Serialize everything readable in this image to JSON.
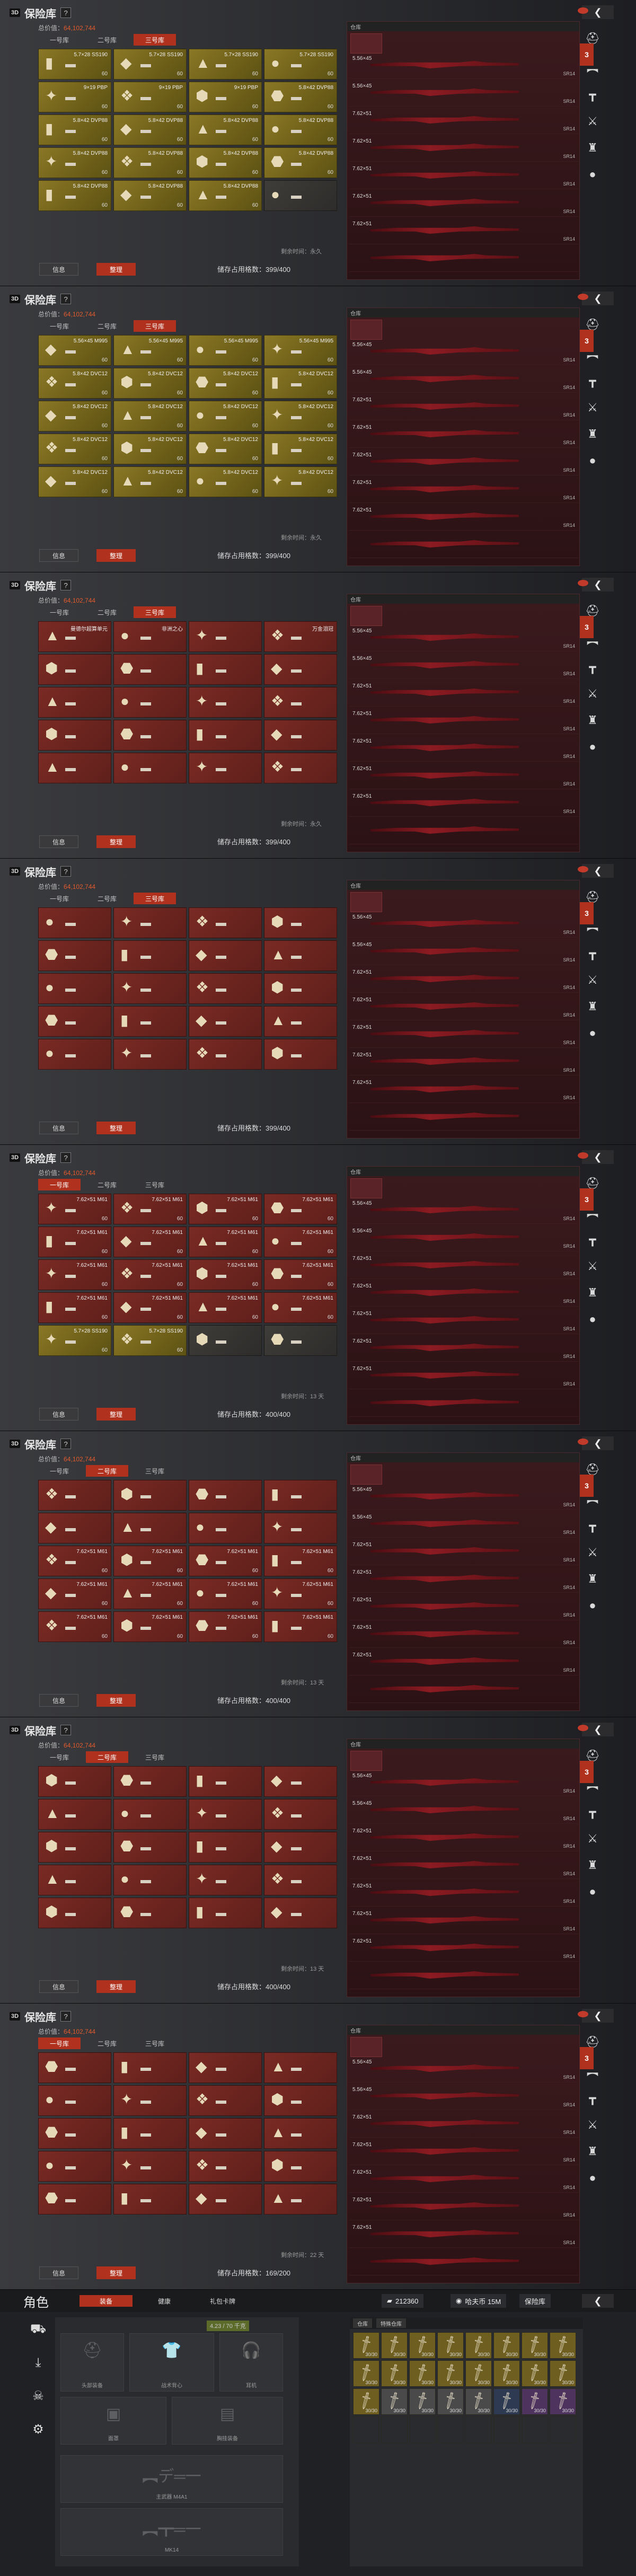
{
  "panels": [
    {
      "title": "保险库",
      "total_label": "总价值：",
      "total_value": "64,102,744",
      "tabs": [
        "一号库",
        "二号库",
        "三号库"
      ],
      "active_tab": 2,
      "cells": [
        {
          "t": "gold",
          "n": "5.7×28 SS190",
          "c": "60"
        },
        {
          "t": "gold",
          "n": "5.7×28 SS190",
          "c": "60"
        },
        {
          "t": "gold",
          "n": "5.7×28 SS190",
          "c": "60"
        },
        {
          "t": "gold",
          "n": "5.7×28 SS190",
          "c": "60"
        },
        {
          "t": "gold",
          "n": "9×19 PBP",
          "c": "60"
        },
        {
          "t": "gold",
          "n": "9×19 PBP",
          "c": "60"
        },
        {
          "t": "gold",
          "n": "9×19 PBP",
          "c": "60"
        },
        {
          "t": "gold",
          "n": "5.8×42 DVP88",
          "c": "60"
        },
        {
          "t": "gold",
          "n": "5.8×42 DVP88",
          "c": "60"
        },
        {
          "t": "gold",
          "n": "5.8×42 DVP88",
          "c": "60"
        },
        {
          "t": "gold",
          "n": "5.8×42 DVP88",
          "c": "60"
        },
        {
          "t": "gold",
          "n": "5.8×42 DVP88",
          "c": "60"
        },
        {
          "t": "gold",
          "n": "5.8×42 DVP88",
          "c": "60"
        },
        {
          "t": "gold",
          "n": "5.8×42 DVP88",
          "c": "60"
        },
        {
          "t": "gold",
          "n": "5.8×42 DVP88",
          "c": "60"
        },
        {
          "t": "gold",
          "n": "5.8×42 DVP88",
          "c": "60"
        },
        {
          "t": "gold",
          "n": "5.8×42 DVP88",
          "c": "60"
        },
        {
          "t": "gold",
          "n": "5.8×42 DVP88",
          "c": "60"
        },
        {
          "t": "gold",
          "n": "5.8×42 DVP88",
          "c": "60"
        },
        {
          "t": "dark",
          "n": "",
          "c": ""
        }
      ],
      "remaining": "剩余时间：永久",
      "usage": "储存占用格数：399/400",
      "btn_info": "信息",
      "btn_sort": "整理"
    },
    {
      "title": "保险库",
      "total_label": "总价值：",
      "total_value": "64,102,744",
      "tabs": [
        "一号库",
        "二号库",
        "三号库"
      ],
      "active_tab": 2,
      "cells": [
        {
          "t": "gold",
          "n": "5.56×45 M995",
          "c": "60"
        },
        {
          "t": "gold",
          "n": "5.56×45 M995",
          "c": "60"
        },
        {
          "t": "gold",
          "n": "5.56×45 M995",
          "c": "60"
        },
        {
          "t": "gold",
          "n": "5.56×45 M995",
          "c": "60"
        },
        {
          "t": "gold",
          "n": "5.8×42 DVC12",
          "c": "60"
        },
        {
          "t": "gold",
          "n": "5.8×42 DVC12",
          "c": "60"
        },
        {
          "t": "gold",
          "n": "5.8×42 DVC12",
          "c": "60"
        },
        {
          "t": "gold",
          "n": "5.8×42 DVC12",
          "c": "60"
        },
        {
          "t": "gold",
          "n": "5.8×42 DVC12",
          "c": "60"
        },
        {
          "t": "gold",
          "n": "5.8×42 DVC12",
          "c": "60"
        },
        {
          "t": "gold",
          "n": "5.8×42 DVC12",
          "c": "60"
        },
        {
          "t": "gold",
          "n": "5.8×42 DVC12",
          "c": "60"
        },
        {
          "t": "gold",
          "n": "5.8×42 DVC12",
          "c": "60"
        },
        {
          "t": "gold",
          "n": "5.8×42 DVC12",
          "c": "60"
        },
        {
          "t": "gold",
          "n": "5.8×42 DVC12",
          "c": "60"
        },
        {
          "t": "gold",
          "n": "5.8×42 DVC12",
          "c": "60"
        },
        {
          "t": "gold",
          "n": "5.8×42 DVC12",
          "c": "60"
        },
        {
          "t": "gold",
          "n": "5.8×42 DVC12",
          "c": "60"
        },
        {
          "t": "gold",
          "n": "5.8×42 DVC12",
          "c": "60"
        },
        {
          "t": "gold",
          "n": "5.8×42 DVC12",
          "c": "60"
        }
      ],
      "remaining": "剩余时间：永久",
      "usage": "储存占用格数：399/400",
      "btn_info": "信息",
      "btn_sort": "整理"
    },
    {
      "title": "保险库",
      "total_label": "总价值：",
      "total_value": "64,102,744",
      "tabs": [
        "一号库",
        "二号库",
        "三号库"
      ],
      "active_tab": 2,
      "cells": [
        {
          "t": "red",
          "n": "曼德尔超算单元",
          "c": ""
        },
        {
          "t": "red",
          "n": "非洲之心",
          "c": ""
        },
        {
          "t": "red",
          "n": "",
          "c": ""
        },
        {
          "t": "red",
          "n": "万金泪冠",
          "c": ""
        },
        {
          "t": "red",
          "n": "",
          "c": ""
        },
        {
          "t": "red",
          "n": "",
          "c": ""
        },
        {
          "t": "red",
          "n": "",
          "c": ""
        },
        {
          "t": "red",
          "n": "",
          "c": ""
        },
        {
          "t": "red",
          "n": "",
          "c": ""
        },
        {
          "t": "red",
          "n": "",
          "c": ""
        },
        {
          "t": "red",
          "n": "",
          "c": ""
        },
        {
          "t": "red",
          "n": "",
          "c": ""
        },
        {
          "t": "red",
          "n": "",
          "c": ""
        },
        {
          "t": "red",
          "n": "",
          "c": ""
        },
        {
          "t": "red",
          "n": "",
          "c": ""
        },
        {
          "t": "red",
          "n": "",
          "c": ""
        },
        {
          "t": "red",
          "n": "",
          "c": ""
        },
        {
          "t": "red",
          "n": "",
          "c": ""
        },
        {
          "t": "red",
          "n": "",
          "c": ""
        },
        {
          "t": "red",
          "n": "",
          "c": ""
        }
      ],
      "remaining": "剩余时间：永久",
      "usage": "储存占用格数：399/400",
      "btn_info": "信息",
      "btn_sort": "整理"
    },
    {
      "title": "保险库",
      "total_label": "总价值：",
      "total_value": "64,102,744",
      "tabs": [
        "一号库",
        "二号库",
        "三号库"
      ],
      "active_tab": 2,
      "cells": [
        {
          "t": "red",
          "n": "",
          "c": ""
        },
        {
          "t": "red",
          "n": "",
          "c": ""
        },
        {
          "t": "red",
          "n": "",
          "c": ""
        },
        {
          "t": "red",
          "n": "",
          "c": ""
        },
        {
          "t": "red",
          "n": "",
          "c": ""
        },
        {
          "t": "red",
          "n": "",
          "c": ""
        },
        {
          "t": "red",
          "n": "",
          "c": ""
        },
        {
          "t": "red",
          "n": "",
          "c": ""
        },
        {
          "t": "red",
          "n": "",
          "c": ""
        },
        {
          "t": "red",
          "n": "",
          "c": ""
        },
        {
          "t": "red",
          "n": "",
          "c": ""
        },
        {
          "t": "red",
          "n": "",
          "c": ""
        },
        {
          "t": "red",
          "n": "",
          "c": ""
        },
        {
          "t": "red",
          "n": "",
          "c": ""
        },
        {
          "t": "red",
          "n": "",
          "c": ""
        },
        {
          "t": "red",
          "n": "",
          "c": ""
        },
        {
          "t": "red",
          "n": "",
          "c": ""
        },
        {
          "t": "red",
          "n": "",
          "c": ""
        },
        {
          "t": "red",
          "n": "",
          "c": ""
        },
        {
          "t": "red",
          "n": "",
          "c": ""
        }
      ],
      "remaining": "",
      "usage": "储存占用格数：399/400",
      "btn_info": "信息",
      "btn_sort": "整理"
    },
    {
      "title": "保险库",
      "total_label": "总价值：",
      "total_value": "64,102,744",
      "tabs": [
        "一号库",
        "二号库",
        "三号库"
      ],
      "active_tab": 0,
      "cells": [
        {
          "t": "red",
          "n": "7.62×51 M61",
          "c": "60"
        },
        {
          "t": "red",
          "n": "7.62×51 M61",
          "c": "60"
        },
        {
          "t": "red",
          "n": "7.62×51 M61",
          "c": "60"
        },
        {
          "t": "red",
          "n": "7.62×51 M61",
          "c": "60"
        },
        {
          "t": "red",
          "n": "7.62×51 M61",
          "c": "60"
        },
        {
          "t": "red",
          "n": "7.62×51 M61",
          "c": "60"
        },
        {
          "t": "red",
          "n": "7.62×51 M61",
          "c": "60"
        },
        {
          "t": "red",
          "n": "7.62×51 M61",
          "c": "60"
        },
        {
          "t": "red",
          "n": "7.62×51 M61",
          "c": "60"
        },
        {
          "t": "red",
          "n": "7.62×51 M61",
          "c": "60"
        },
        {
          "t": "red",
          "n": "7.62×51 M61",
          "c": "60"
        },
        {
          "t": "red",
          "n": "7.62×51 M61",
          "c": "60"
        },
        {
          "t": "red",
          "n": "7.62×51 M61",
          "c": "60"
        },
        {
          "t": "red",
          "n": "7.62×51 M61",
          "c": "60"
        },
        {
          "t": "red",
          "n": "7.62×51 M61",
          "c": "60"
        },
        {
          "t": "red",
          "n": "7.62×51 M61",
          "c": "60"
        },
        {
          "t": "gold",
          "n": "5.7×28 SS190",
          "c": "60"
        },
        {
          "t": "gold",
          "n": "5.7×28 SS190",
          "c": "60"
        },
        {
          "t": "dark",
          "n": "",
          "c": ""
        },
        {
          "t": "dark",
          "n": "",
          "c": ""
        }
      ],
      "remaining": "剩余时间：13 天",
      "usage": "储存占用格数：400/400",
      "btn_info": "信息",
      "btn_sort": "整理"
    },
    {
      "title": "保险库",
      "total_label": "总价值：",
      "total_value": "64,102,744",
      "tabs": [
        "一号库",
        "二号库",
        "三号库"
      ],
      "active_tab": 1,
      "cells": [
        {
          "t": "red",
          "n": "",
          "c": ""
        },
        {
          "t": "red",
          "n": "",
          "c": ""
        },
        {
          "t": "red",
          "n": "",
          "c": ""
        },
        {
          "t": "red",
          "n": "",
          "c": ""
        },
        {
          "t": "red",
          "n": "",
          "c": ""
        },
        {
          "t": "red",
          "n": "",
          "c": ""
        },
        {
          "t": "red",
          "n": "",
          "c": ""
        },
        {
          "t": "red",
          "n": "",
          "c": ""
        },
        {
          "t": "red",
          "n": "7.62×51 M61",
          "c": "60"
        },
        {
          "t": "red",
          "n": "7.62×51 M61",
          "c": "60"
        },
        {
          "t": "red",
          "n": "7.62×51 M61",
          "c": "60"
        },
        {
          "t": "red",
          "n": "7.62×51 M61",
          "c": "60"
        },
        {
          "t": "red",
          "n": "7.62×51 M61",
          "c": "60"
        },
        {
          "t": "red",
          "n": "7.62×51 M61",
          "c": "60"
        },
        {
          "t": "red",
          "n": "7.62×51 M61",
          "c": "60"
        },
        {
          "t": "red",
          "n": "7.62×51 M61",
          "c": "60"
        },
        {
          "t": "red",
          "n": "7.62×51 M61",
          "c": "60"
        },
        {
          "t": "red",
          "n": "7.62×51 M61",
          "c": "60"
        },
        {
          "t": "red",
          "n": "7.62×51 M61",
          "c": "60"
        },
        {
          "t": "red",
          "n": "7.62×51 M61",
          "c": "60"
        }
      ],
      "remaining": "剩余时间：13 天",
      "usage": "储存占用格数：400/400",
      "btn_info": "信息",
      "btn_sort": "整理"
    },
    {
      "title": "保险库",
      "total_label": "总价值：",
      "total_value": "64,102,744",
      "tabs": [
        "一号库",
        "二号库",
        "三号库"
      ],
      "active_tab": 1,
      "cells": [
        {
          "t": "red",
          "n": "",
          "c": ""
        },
        {
          "t": "red",
          "n": "",
          "c": ""
        },
        {
          "t": "red",
          "n": "",
          "c": ""
        },
        {
          "t": "red",
          "n": "",
          "c": ""
        },
        {
          "t": "red",
          "n": "",
          "c": ""
        },
        {
          "t": "red",
          "n": "",
          "c": ""
        },
        {
          "t": "red",
          "n": "",
          "c": ""
        },
        {
          "t": "red",
          "n": "",
          "c": ""
        },
        {
          "t": "red",
          "n": "",
          "c": ""
        },
        {
          "t": "red",
          "n": "",
          "c": ""
        },
        {
          "t": "red",
          "n": "",
          "c": ""
        },
        {
          "t": "red",
          "n": "",
          "c": ""
        },
        {
          "t": "red",
          "n": "",
          "c": ""
        },
        {
          "t": "red",
          "n": "",
          "c": ""
        },
        {
          "t": "red",
          "n": "",
          "c": ""
        },
        {
          "t": "red",
          "n": "",
          "c": ""
        },
        {
          "t": "red",
          "n": "",
          "c": ""
        },
        {
          "t": "red",
          "n": "",
          "c": ""
        },
        {
          "t": "red",
          "n": "",
          "c": ""
        },
        {
          "t": "red",
          "n": "",
          "c": ""
        }
      ],
      "remaining": "剩余时间：13 天",
      "usage": "储存占用格数：400/400",
      "btn_info": "信息",
      "btn_sort": "整理"
    },
    {
      "title": "保险库",
      "total_label": "总价值：",
      "total_value": "64,102,744",
      "tabs": [
        "一号库",
        "二号库",
        "三号库"
      ],
      "active_tab": 0,
      "cells": [
        {
          "t": "red",
          "n": "",
          "c": ""
        },
        {
          "t": "red",
          "n": "",
          "c": ""
        },
        {
          "t": "red",
          "n": "",
          "c": ""
        },
        {
          "t": "red",
          "n": "",
          "c": ""
        },
        {
          "t": "red",
          "n": "",
          "c": ""
        },
        {
          "t": "red",
          "n": "",
          "c": ""
        },
        {
          "t": "red",
          "n": "",
          "c": ""
        },
        {
          "t": "red",
          "n": "",
          "c": ""
        },
        {
          "t": "red",
          "n": "",
          "c": ""
        },
        {
          "t": "red",
          "n": "",
          "c": ""
        },
        {
          "t": "red",
          "n": "",
          "c": ""
        },
        {
          "t": "red",
          "n": "",
          "c": ""
        },
        {
          "t": "red",
          "n": "",
          "c": ""
        },
        {
          "t": "red",
          "n": "",
          "c": ""
        },
        {
          "t": "red",
          "n": "",
          "c": ""
        },
        {
          "t": "red",
          "n": "",
          "c": ""
        },
        {
          "t": "red",
          "n": "",
          "c": ""
        },
        {
          "t": "red",
          "n": "",
          "c": ""
        },
        {
          "t": "red",
          "n": "",
          "c": ""
        },
        {
          "t": "red",
          "n": "",
          "c": ""
        }
      ],
      "remaining": "剩余时间：22 天",
      "usage": "储存占用格数：169/200",
      "btn_info": "信息",
      "btn_sort": "整理"
    }
  ],
  "stash_rows": [
    {
      "cal": "",
      "sub": "",
      "sub2": ""
    },
    {
      "cal": "5.56×45",
      "sub": "",
      "sub2": "SR14"
    },
    {
      "cal": "5.56×45",
      "sub": "",
      "sub2": "SR14"
    },
    {
      "cal": "7.62×51",
      "sub": "",
      "sub2": "SR14"
    },
    {
      "cal": "7.62×51",
      "sub": "",
      "sub2": "SR14"
    },
    {
      "cal": "7.62×51",
      "sub": "",
      "sub2": "SR14"
    },
    {
      "cal": "7.62×51",
      "sub": "",
      "sub2": "SR14"
    },
    {
      "cal": "7.62×51",
      "sub": "",
      "sub2": "SR14"
    },
    {
      "cal": "",
      "sub": "",
      "sub2": ""
    }
  ],
  "stash_header": "仓库",
  "side_icons": [
    "helmet-icon",
    "rifle-icon",
    "pistol-icon",
    "knife-icon",
    "armor-icon",
    "grenade-icon"
  ],
  "character": {
    "title": "角色",
    "tabs": [
      "装备",
      "健康",
      "礼包卡牌"
    ],
    "active_tab": 0,
    "currency": [
      {
        "icon": "bullet-icon",
        "v": "212360"
      },
      {
        "icon": "",
        "v": "哈夫币 15M"
      }
    ],
    "vault_btn": "保险库",
    "weight": "4.23 / 70 千克",
    "gear_labels": [
      "头盔",
      "胸挂",
      "护甲",
      "背包",
      "主武器",
      "副武器",
      "近战"
    ],
    "slot_labels": [
      "头部装备",
      "战术背心",
      "耳机",
      "面罩",
      "胸挂装备",
      "背包"
    ],
    "weapon_label": "主武器 M4A1",
    "sec_label": "MK14",
    "inv_tabs": [
      "仓库",
      "特殊仓库"
    ],
    "inv_counts": [
      "30/30",
      "30/30",
      "30/30",
      "30/30",
      "30/30",
      "30/30",
      "30/30",
      "30/30",
      "30/30",
      "30/30",
      "30/30",
      "30/30",
      "30/30",
      "30/30",
      "30/30",
      "30/30",
      "30/30",
      "30/30",
      "30/30",
      "30/30",
      "30/30",
      "30/30",
      "30/30",
      "30/30",
      "",
      "",
      "",
      "",
      "",
      "",
      "",
      ""
    ]
  }
}
